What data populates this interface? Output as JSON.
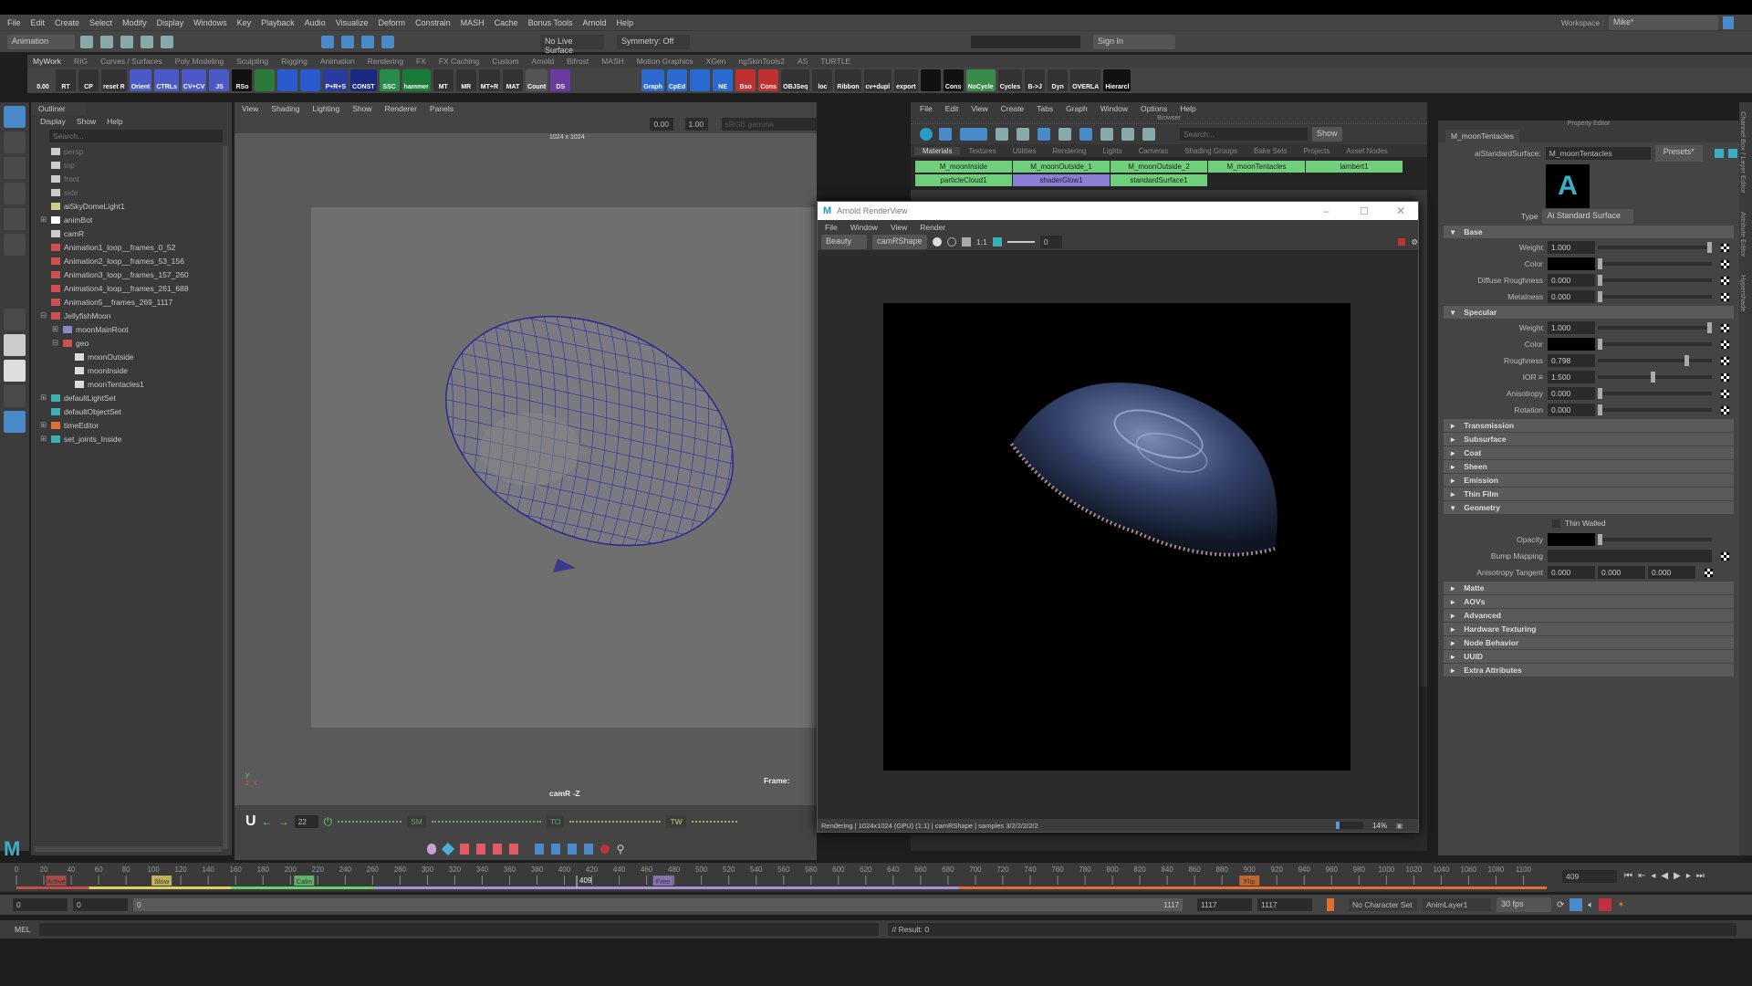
{
  "menubar": [
    "File",
    "Edit",
    "Create",
    "Select",
    "Modify",
    "Display",
    "Windows",
    "Key",
    "Playback",
    "Audio",
    "Visualize",
    "Deform",
    "Constrain",
    "MASH",
    "Cache",
    "Bonus Tools",
    "Arnold",
    "Help"
  ],
  "workspace": {
    "label": "Workspace :",
    "value": "Mike*"
  },
  "status": {
    "mode": "Animation",
    "live": "No Live Surface",
    "symmetry": "Symmetry: Off",
    "signin": "Sign In"
  },
  "shelf_tabs": [
    "MyWork",
    "RIG",
    "Curves / Surfaces",
    "Poly Modeling",
    "Sculpting",
    "Rigging",
    "Animation",
    "Rendering",
    "FX",
    "FX Caching",
    "Custom",
    "Arnold",
    "Bifrost",
    "MASH",
    "Motion Graphics",
    "XGen",
    "ngSkinTools2",
    "AS",
    "TURTLE"
  ],
  "shelf_buttons": [
    {
      "label": "0.00",
      "color": "#444"
    },
    {
      "label": "RT",
      "color": "#333"
    },
    {
      "label": "CP",
      "color": "#333"
    },
    {
      "label": "reset R",
      "color": "#333"
    },
    {
      "label": "Orient",
      "color": "#4a58c8"
    },
    {
      "label": "CTRLs",
      "color": "#4a58c8"
    },
    {
      "label": "CV+CV",
      "color": "#4a58c8"
    },
    {
      "label": "JS",
      "color": "#4a58c8"
    },
    {
      "label": "RSo",
      "color": "#111"
    },
    {
      "label": "",
      "color": "#2a7a3a"
    },
    {
      "label": "",
      "color": "#2a5ad0"
    },
    {
      "label": "",
      "color": "#2a5ad0"
    },
    {
      "label": "P+R+S",
      "color": "#2a3aa0"
    },
    {
      "label": "CONST",
      "color": "#1a2a80"
    },
    {
      "label": "SSC",
      "color": "#2a8a4a"
    },
    {
      "label": "hammer",
      "color": "#1a7a3a"
    },
    {
      "label": "MT",
      "color": "#333"
    },
    {
      "label": "MR",
      "color": "#333"
    },
    {
      "label": "MT+R",
      "color": "#333"
    },
    {
      "label": "MAT",
      "color": "#333"
    },
    {
      "label": "Count",
      "color": "#555"
    },
    {
      "label": "DS",
      "color": "#6a3aa0"
    },
    {
      "label": "",
      "color": "#444"
    },
    {
      "label": "",
      "color": "#444"
    },
    {
      "label": "",
      "color": "#444"
    },
    {
      "label": "Graph",
      "color": "#2a6ad0"
    },
    {
      "label": "CpEd",
      "color": "#2a6ad0"
    },
    {
      "label": "",
      "color": "#2a6ad0"
    },
    {
      "label": "NE",
      "color": "#2a6ad0"
    },
    {
      "label": "Bso",
      "color": "#c03030"
    },
    {
      "label": "Cons",
      "color": "#c03030"
    },
    {
      "label": "OBJSeq",
      "color": "#333"
    },
    {
      "label": "loc",
      "color": "#333"
    },
    {
      "label": "Ribbon",
      "color": "#333"
    },
    {
      "label": "cv+dupl",
      "color": "#333"
    },
    {
      "label": "export",
      "color": "#333"
    },
    {
      "label": "",
      "color": "#111"
    },
    {
      "label": "Cons",
      "color": "#111"
    },
    {
      "label": "NoCycle",
      "color": "#3a8a4a"
    },
    {
      "label": "Cycles",
      "color": "#333"
    },
    {
      "label": "B->J",
      "color": "#333"
    },
    {
      "label": "Dyn",
      "color": "#333"
    },
    {
      "label": "OVERLA",
      "color": "#333"
    },
    {
      "label": "Hierarcl",
      "color": "#111"
    }
  ],
  "outliner": {
    "title": "Outliner",
    "menu": [
      "Display",
      "Show",
      "Help"
    ],
    "search_placeholder": "Search...",
    "items": [
      {
        "label": "persp",
        "indent": 0,
        "type": "camera",
        "dim": true
      },
      {
        "label": "top",
        "indent": 0,
        "type": "camera",
        "dim": true
      },
      {
        "label": "front",
        "indent": 0,
        "type": "camera",
        "dim": true
      },
      {
        "label": "side",
        "indent": 0,
        "type": "camera",
        "dim": true
      },
      {
        "label": "aiSkyDomeLight1",
        "indent": 0,
        "type": "light"
      },
      {
        "label": "animBot",
        "indent": 0,
        "type": "magnet",
        "exp": "+"
      },
      {
        "label": "camR",
        "indent": 0,
        "type": "camera"
      },
      {
        "label": "Animation1_loop__frames_0_52",
        "indent": 0,
        "type": "clip"
      },
      {
        "label": "Animation2_loop__frames_53_156",
        "indent": 0,
        "type": "clip"
      },
      {
        "label": "Animation3_loop__frames_157_260",
        "indent": 0,
        "type": "clip"
      },
      {
        "label": "Animation4_loop__frames_261_688",
        "indent": 0,
        "type": "clip"
      },
      {
        "label": "Animation5__frames_269_1117",
        "indent": 0,
        "type": "clip"
      },
      {
        "label": "JellyfishMoon",
        "indent": 0,
        "type": "clip",
        "exp": "-"
      },
      {
        "label": "moonMainRoot",
        "indent": 1,
        "type": "joint",
        "exp": "+"
      },
      {
        "label": "geo",
        "indent": 1,
        "type": "clip",
        "exp": "-"
      },
      {
        "label": "moonOutside",
        "indent": 2,
        "type": "mesh"
      },
      {
        "label": "moonInside",
        "indent": 2,
        "type": "mesh"
      },
      {
        "label": "moonTentacles1",
        "indent": 2,
        "type": "mesh"
      },
      {
        "label": "defaultLightSet",
        "indent": 0,
        "type": "set",
        "exp": "+"
      },
      {
        "label": "defaultObjectSet",
        "indent": 0,
        "type": "set"
      },
      {
        "label": "timeEditor",
        "indent": 0,
        "type": "time",
        "exp": "+"
      },
      {
        "label": "set_joints_Inside",
        "indent": 0,
        "type": "set",
        "exp": "+"
      }
    ]
  },
  "viewport": {
    "menu": [
      "View",
      "Shading",
      "Lighting",
      "Show",
      "Renderer",
      "Panels"
    ],
    "exposure": "0.00",
    "gamma": "1.00",
    "colorspace": "sRGB gamma",
    "resolution": "1024 x 1024",
    "camera": "camR -Z",
    "frame_label": "Frame:"
  },
  "animbot": {
    "frame": "22",
    "labels": [
      "SM",
      "TO",
      "TW"
    ]
  },
  "hypershade": {
    "menu": [
      "File",
      "Edit",
      "View",
      "Create",
      "Tabs",
      "Graph",
      "Window",
      "Options",
      "Help"
    ],
    "browser_title": "Browser",
    "search_placeholder": "Search...",
    "show": "Show",
    "tabs": [
      "Materials",
      "Textures",
      "Utilities",
      "Rendering",
      "Lights",
      "Cameras",
      "Shading Groups",
      "Bake Sets",
      "Projects",
      "Asset Nodes"
    ],
    "materials": [
      {
        "name": "M_moonInside",
        "color": "#6fcf7a"
      },
      {
        "name": "M_moonOutside_1",
        "color": "#6fcf7a"
      },
      {
        "name": "M_moonOutside_2",
        "color": "#6fcf7a"
      },
      {
        "name": "M_moonTentacles",
        "color": "#6fcf7a"
      },
      {
        "name": "lambert1",
        "color": "#6fcf7a"
      },
      {
        "name": "particleCloud1",
        "color": "#6fcf7a"
      },
      {
        "name": "shaderGlow1",
        "color": "#8a7fd6"
      },
      {
        "name": "standardSurface1",
        "color": "#6fcf7a"
      }
    ]
  },
  "renderview": {
    "title": "Arnold RenderView",
    "menu": [
      "File",
      "Window",
      "View",
      "Render"
    ],
    "aov": "Beauty",
    "camera": "camRShape",
    "ratio": "1:1",
    "exposure": "0",
    "status": "Rendering | 1024x1024 (GPU) (1:1) | camRShape | samples 3/2/2/2/2/2",
    "progress_text": "14%",
    "progress": 0.14
  },
  "property_editor": {
    "title": "Property Editor",
    "tab": "M_moonTentacles",
    "node_type": "aiStandardSurface:",
    "node_name": "M_moonTentacles",
    "presets": "Presets*",
    "type_label": "Type",
    "type_value": "Ai Standard Surface",
    "base": {
      "title": "Base",
      "attrs": [
        {
          "label": "Weight",
          "value": "1.000",
          "slider": 1.0
        },
        {
          "label": "Color",
          "value": "",
          "slider": 0,
          "color": true
        },
        {
          "label": "Diffuse Roughness",
          "value": "0.000",
          "slider": 0
        },
        {
          "label": "Metalness",
          "value": "0.000",
          "slider": 0
        }
      ]
    },
    "specular": {
      "title": "Specular",
      "attrs": [
        {
          "label": "Weight",
          "value": "1.000",
          "slider": 1.0
        },
        {
          "label": "Color",
          "value": "",
          "slider": 0,
          "color": true
        },
        {
          "label": "Roughness",
          "value": "0.798",
          "slider": 0.798
        },
        {
          "label": "IOR ≡",
          "value": "1.500",
          "slider": 0.5
        },
        {
          "label": "Anisotropy",
          "value": "0.000",
          "slider": 0
        },
        {
          "label": "Rotation",
          "value": "0.000",
          "slider": 0
        }
      ]
    },
    "collapsed1": [
      "Transmission",
      "Subsurface",
      "Coat",
      "Sheen",
      "Emission",
      "Thin Film"
    ],
    "geometry": {
      "title": "Geometry",
      "thin_walled": "Thin Walled",
      "opacity": "Opacity",
      "bump": "Bump Mapping",
      "aniso_tangent": "Anisotropy Tangent",
      "tangent_values": [
        "0.000",
        "0.000",
        "0.000"
      ]
    },
    "collapsed2": [
      "Matte",
      "AOVs",
      "Advanced",
      "Hardware Texturing",
      "Node Behavior",
      "UUID",
      "Extra Attributes"
    ],
    "side_tabs": [
      "Channel Box / Layer Editor",
      "Attribute Editor",
      "Hypershade"
    ]
  },
  "timeline": {
    "ticks": [
      "0",
      "20",
      "40",
      "60",
      "80",
      "100",
      "120",
      "140",
      "160",
      "180",
      "200",
      "220",
      "240",
      "260",
      "280",
      "300",
      "320",
      "340",
      "360",
      "380",
      "400",
      "420",
      "440",
      "460",
      "480",
      "500",
      "520",
      "540",
      "560",
      "580",
      "600",
      "620",
      "640",
      "660",
      "680",
      "700",
      "720",
      "740",
      "760",
      "780",
      "800",
      "820",
      "840",
      "860",
      "880",
      "900",
      "920",
      "940",
      "960",
      "980",
      "1000",
      "1020",
      "1040",
      "1060",
      "1080",
      "1100"
    ],
    "max": 1117,
    "current": "409",
    "current_value": 409,
    "markers": [
      {
        "label": "Active",
        "frame": 27,
        "color": "#c0504a"
      },
      {
        "label": "Slow",
        "frame": 104,
        "color": "#e0d060"
      },
      {
        "label": "Calm",
        "frame": 208,
        "color": "#6ad070"
      },
      {
        "label": "Free",
        "frame": 470,
        "color": "#9a80d0"
      },
      {
        "label": "Flip",
        "frame": 898,
        "color": "#e07030"
      }
    ],
    "segments": [
      {
        "from": 0,
        "to": 53,
        "color": "#c0504a"
      },
      {
        "from": 53,
        "to": 157,
        "color": "#e0d060"
      },
      {
        "from": 157,
        "to": 261,
        "color": "#6ad070"
      },
      {
        "from": 261,
        "to": 688,
        "color": "#a890d8"
      },
      {
        "from": 688,
        "to": 1117,
        "color": "#e07030"
      }
    ]
  },
  "range": {
    "start": "0",
    "anim_start": "0",
    "slider_start": "0",
    "slider_end": "1117",
    "end": "1117",
    "anim_end": "1117",
    "char_set": "No Character Set",
    "anim_layer": "AnimLayer1",
    "fps": "30 fps"
  },
  "cmd": {
    "lang": "MEL",
    "result": "// Result: 0"
  }
}
